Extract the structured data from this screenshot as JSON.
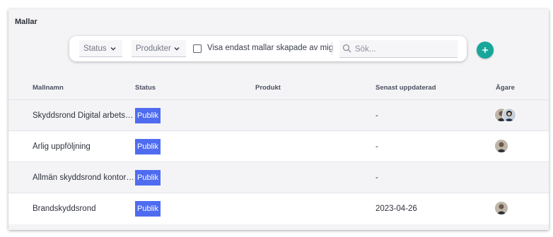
{
  "panel": {
    "title": "Mallar"
  },
  "filters": {
    "status_label": "Status",
    "product_label": "Produkter",
    "only_mine_label": "Visa endast mallar skapade av mig",
    "only_mine_checked": false,
    "search_placeholder": "Sök...",
    "search_value": ""
  },
  "table": {
    "headers": {
      "name": "Mallnamn",
      "status": "Status",
      "product": "Produkt",
      "updated": "Senast uppdaterad",
      "owner": "Ägare"
    },
    "rows": [
      {
        "name": "Skyddsrond Digital arbetsmiljö",
        "status": "Publik",
        "product": "",
        "updated": "-",
        "owners": 2
      },
      {
        "name": "Årlig uppföljning",
        "status": "Publik",
        "product": "",
        "updated": "-",
        "owners": 1
      },
      {
        "name": "Allmän skyddsrond kontor/butik",
        "status": "Publik",
        "product": "",
        "updated": "-",
        "owners": 0
      },
      {
        "name": "Brandskyddsrond",
        "status": "Publik",
        "product": "",
        "updated": "2023-04-26",
        "owners": 1
      }
    ]
  },
  "icons": {
    "dropdown": "chevron-down-icon",
    "search": "search-icon",
    "add": "plus-icon",
    "avatar": "avatar-photo"
  },
  "colors": {
    "accent": "#17a69a",
    "badge": "#4f6cf0",
    "panel_bg": "#f4f4f6"
  }
}
